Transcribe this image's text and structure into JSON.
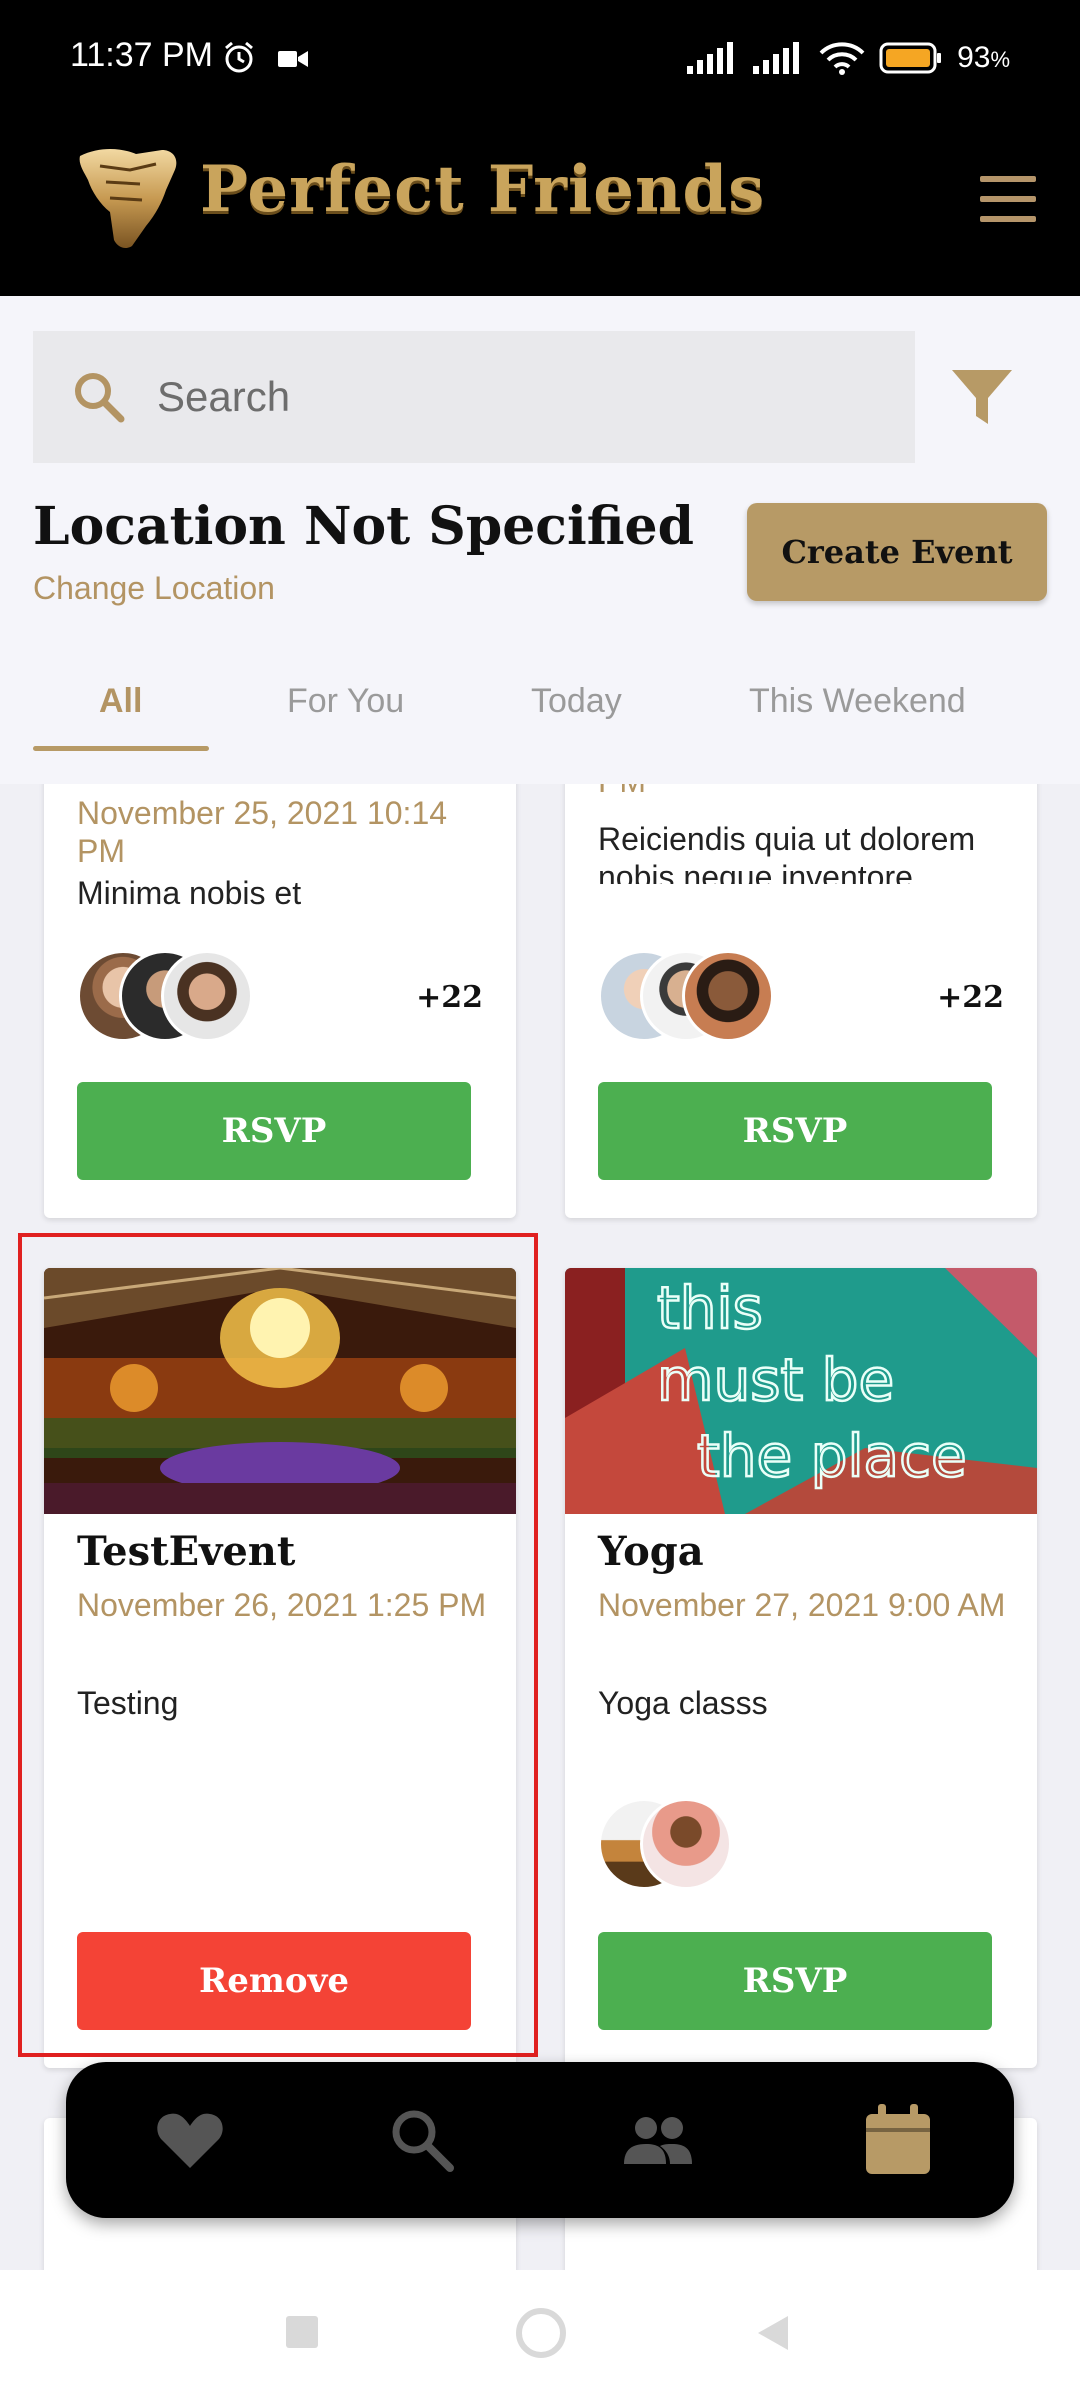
{
  "status": {
    "time": "11:37 PM",
    "battery": "93"
  },
  "header": {
    "app_name": "Perfect Friends"
  },
  "search": {
    "placeholder": "Search"
  },
  "location": {
    "title": "Location Not Specified",
    "change_label": "Change Location"
  },
  "actions": {
    "create_event": "Create Event"
  },
  "tabs": [
    {
      "label": "All",
      "active": true
    },
    {
      "label": "For You",
      "active": false
    },
    {
      "label": "Today",
      "active": false
    },
    {
      "label": "This Weekend",
      "active": false
    }
  ],
  "events": [
    {
      "date": "November 25, 2021 10:14 PM",
      "description": "Minima nobis et",
      "extra_count": "+22",
      "action": "RSVP"
    },
    {
      "date": "PM",
      "description": "Reiciendis quia ut dolorem nobis neque inventore",
      "extra_count": "+22",
      "action": "RSVP"
    },
    {
      "title": "TestEvent",
      "date": "November 26, 2021 1:25 PM",
      "description": "Testing",
      "action": "Remove",
      "image": "banquet-hall-photo"
    },
    {
      "title": "Yoga",
      "date": "November 27, 2021 9:00 AM",
      "description": "Yoga classs",
      "action": "RSVP",
      "image": "neon-sign-photo"
    }
  ],
  "colors": {
    "gold": "#b79a66",
    "rsvp": "#4caf50",
    "remove": "#f44336",
    "header": "#000000"
  },
  "nav": [
    {
      "icon": "heart-icon",
      "active": false
    },
    {
      "icon": "search-icon",
      "active": false
    },
    {
      "icon": "people-icon",
      "active": false
    },
    {
      "icon": "calendar-icon",
      "active": true
    }
  ]
}
